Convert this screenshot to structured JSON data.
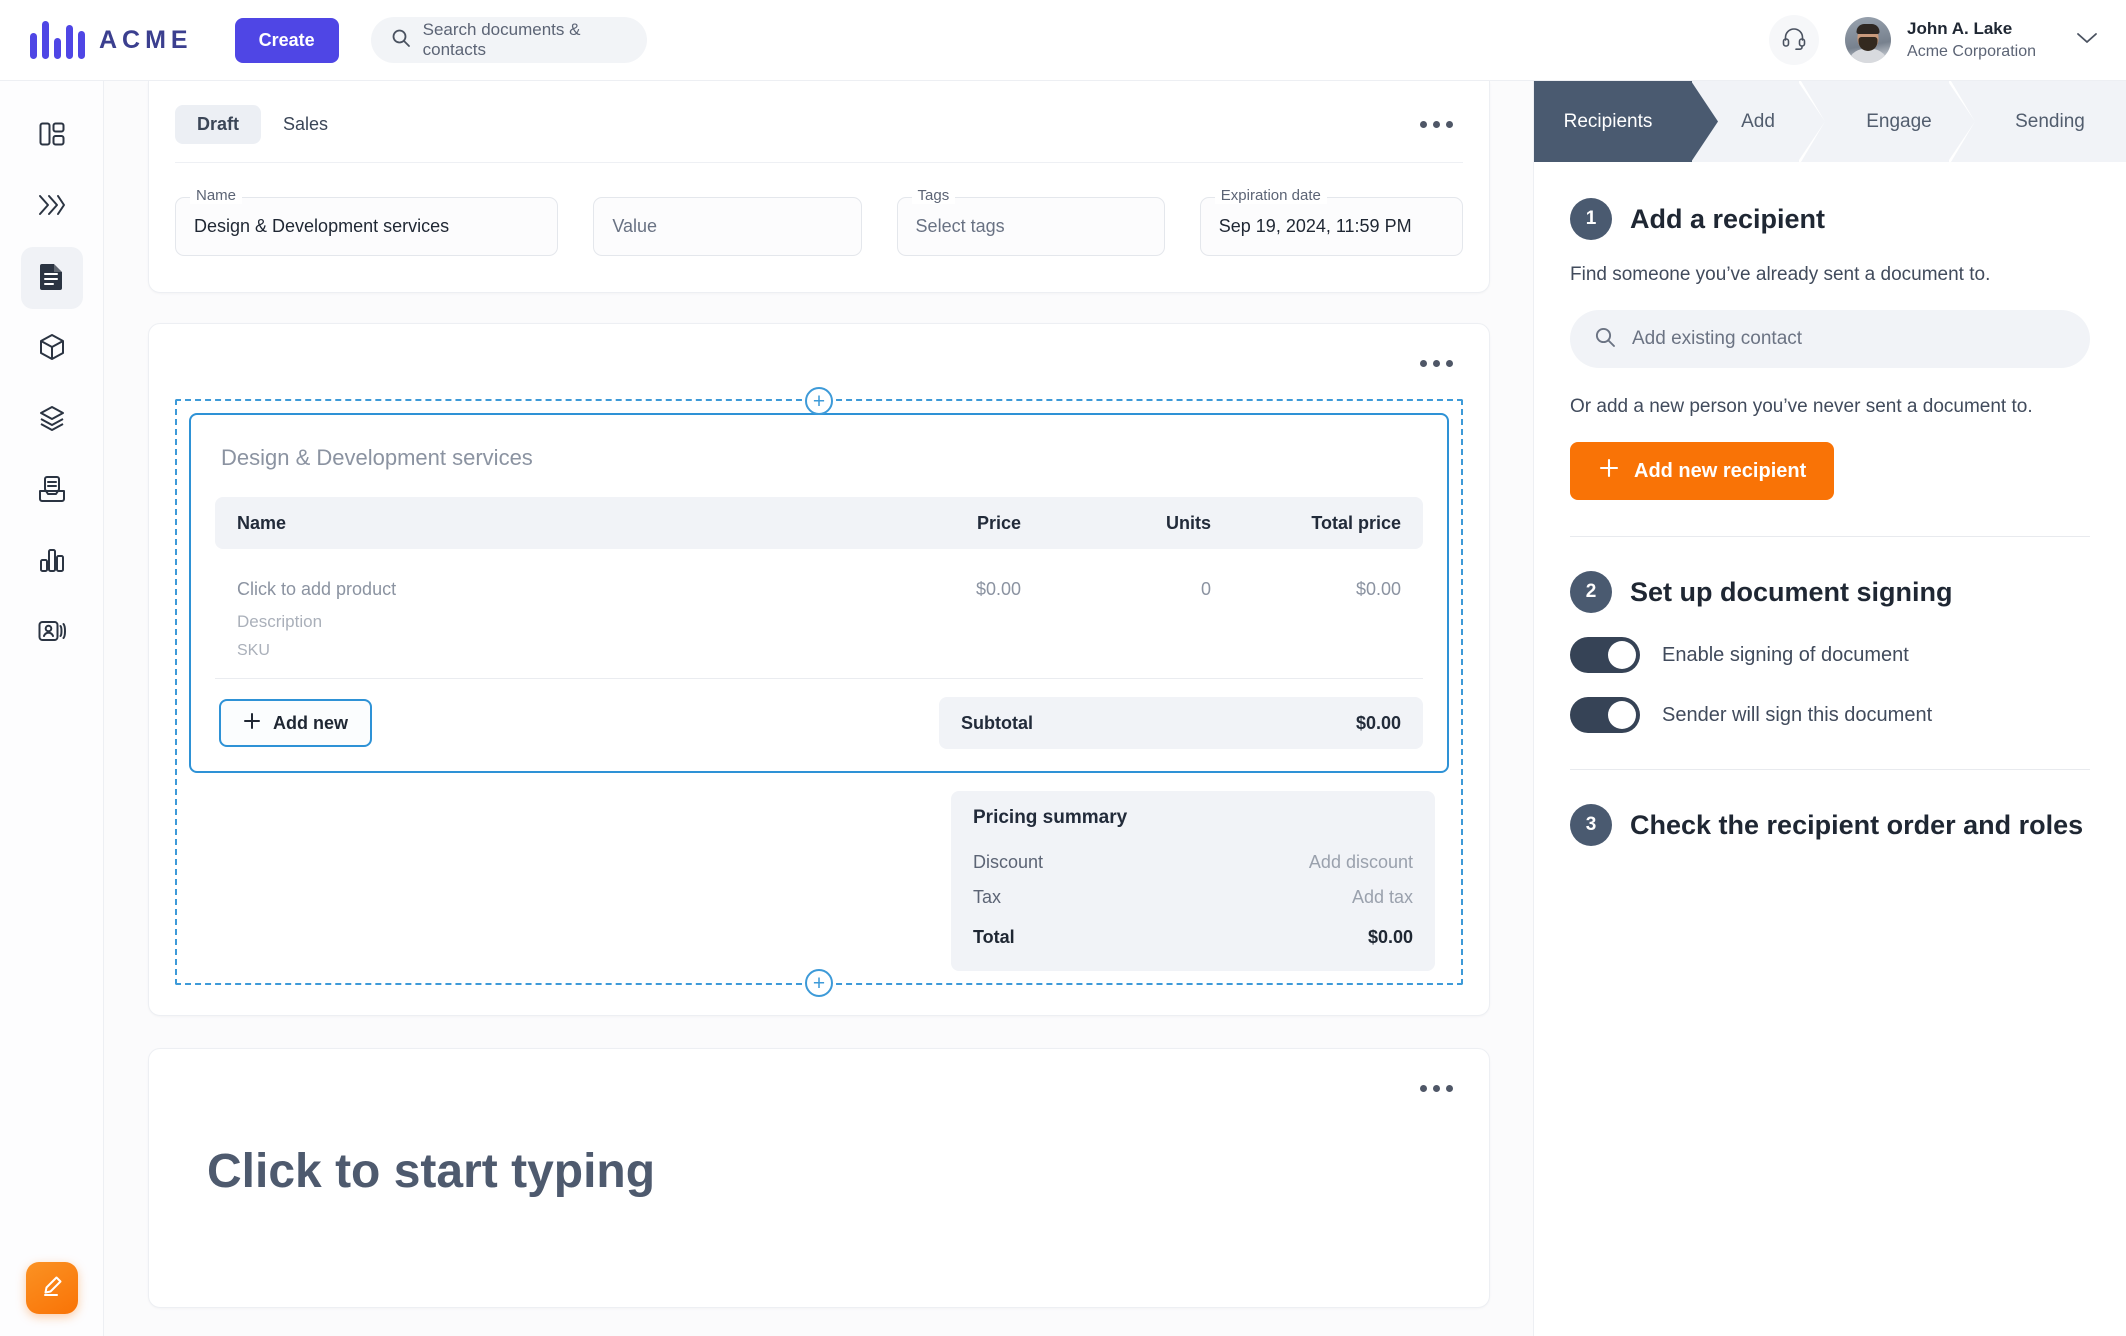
{
  "topbar": {
    "brand": "ACME",
    "create_label": "Create",
    "search": {
      "placeholder": "Search documents & contacts",
      "icon": "search-icon"
    },
    "support_icon": "headset-icon",
    "user": {
      "name": "John A. Lake",
      "org": "Acme Corporation"
    },
    "chevron_icon": "chevron-down-icon"
  },
  "rail": {
    "items": [
      {
        "name": "dashboard",
        "icon": "dashboard-layout-icon",
        "active": false
      },
      {
        "name": "workflow",
        "icon": "double-chevron-right-icon",
        "active": false
      },
      {
        "name": "documents",
        "icon": "document-icon",
        "active": true
      },
      {
        "name": "products",
        "icon": "cube-icon",
        "active": false
      },
      {
        "name": "templates",
        "icon": "layers-icon",
        "active": false
      },
      {
        "name": "inbox",
        "icon": "document-inbox-icon",
        "active": false
      },
      {
        "name": "reports",
        "icon": "bar-chart-icon",
        "active": false
      },
      {
        "name": "contacts",
        "icon": "contact-card-icon",
        "active": false
      }
    ],
    "fab_icon": "pencil-edit-icon"
  },
  "document": {
    "tabs": [
      {
        "label": "Draft",
        "active": true
      },
      {
        "label": "Sales",
        "active": false
      }
    ],
    "more_icon": "ellipsis-icon",
    "fields": [
      {
        "legend": "Name",
        "value": "Design & Development services",
        "placeholder": false
      },
      {
        "legend": "",
        "value": "Value",
        "placeholder": true
      },
      {
        "legend": "Tags",
        "value": "Select tags",
        "placeholder": true
      },
      {
        "legend": "Expiration date",
        "value": "Sep 19, 2024, 11:59 PM",
        "placeholder": false
      }
    ]
  },
  "block": {
    "more_icon": "ellipsis-icon",
    "add_handle_icon": "plus-circle-icon",
    "title": "Design & Development services",
    "table": {
      "columns": [
        "Name",
        "Price",
        "Units",
        "Total price"
      ],
      "rows": [
        {
          "name": "Click to add product",
          "description": "Description",
          "sku": "SKU",
          "price": "$0.00",
          "units": "0",
          "total": "$0.00"
        }
      ]
    },
    "add_new_label": "Add new",
    "add_new_icon": "plus-icon",
    "subtotal_label": "Subtotal",
    "subtotal_value": "$0.00",
    "pricing": {
      "title": "Pricing summary",
      "rows": [
        {
          "label": "Discount",
          "value": "Add discount"
        },
        {
          "label": "Tax",
          "value": "Add tax"
        }
      ],
      "total_label": "Total",
      "total_value": "$0.00"
    }
  },
  "typing_block": {
    "more_icon": "ellipsis-icon",
    "placeholder": "Click to start typing"
  },
  "right_panel": {
    "steps": [
      {
        "label": "Recipients",
        "active": true
      },
      {
        "label": "Add",
        "active": false
      },
      {
        "label": "Engage",
        "active": false
      },
      {
        "label": "Sending",
        "active": false
      }
    ],
    "step1": {
      "number": "1",
      "title": "Add a recipient",
      "description": "Find someone you’ve already sent a document to.",
      "search_placeholder": "Add existing contact",
      "search_icon": "search-icon",
      "description2": "Or add a new person you’ve never sent a document to.",
      "add_button": "Add new recipient",
      "add_button_icon": "plus-icon"
    },
    "step2": {
      "number": "2",
      "title": "Set up document signing",
      "toggles": [
        {
          "label": "Enable signing of document",
          "on": true
        },
        {
          "label": "Sender will sign this document",
          "on": true
        }
      ]
    },
    "step3": {
      "number": "3",
      "title": "Check the recipient order and roles"
    }
  },
  "colors": {
    "brand_purple": "#4f46e5",
    "accent_orange": "#f97306",
    "step_active": "#4a5a70",
    "selection_blue": "#2e92d6"
  }
}
